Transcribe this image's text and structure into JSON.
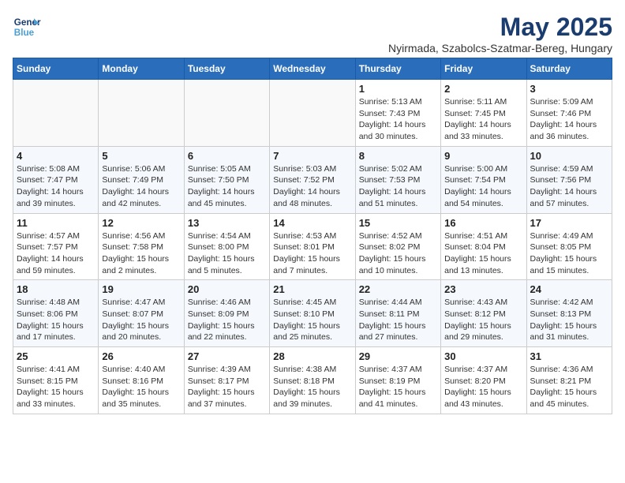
{
  "logo": {
    "text_general": "General",
    "text_blue": "Blue"
  },
  "title": "May 2025",
  "location": "Nyirmada, Szabolcs-Szatmar-Bereg, Hungary",
  "headers": [
    "Sunday",
    "Monday",
    "Tuesday",
    "Wednesday",
    "Thursday",
    "Friday",
    "Saturday"
  ],
  "weeks": [
    [
      {
        "day": "",
        "info": ""
      },
      {
        "day": "",
        "info": ""
      },
      {
        "day": "",
        "info": ""
      },
      {
        "day": "",
        "info": ""
      },
      {
        "day": "1",
        "info": "Sunrise: 5:13 AM\nSunset: 7:43 PM\nDaylight: 14 hours\nand 30 minutes."
      },
      {
        "day": "2",
        "info": "Sunrise: 5:11 AM\nSunset: 7:45 PM\nDaylight: 14 hours\nand 33 minutes."
      },
      {
        "day": "3",
        "info": "Sunrise: 5:09 AM\nSunset: 7:46 PM\nDaylight: 14 hours\nand 36 minutes."
      }
    ],
    [
      {
        "day": "4",
        "info": "Sunrise: 5:08 AM\nSunset: 7:47 PM\nDaylight: 14 hours\nand 39 minutes."
      },
      {
        "day": "5",
        "info": "Sunrise: 5:06 AM\nSunset: 7:49 PM\nDaylight: 14 hours\nand 42 minutes."
      },
      {
        "day": "6",
        "info": "Sunrise: 5:05 AM\nSunset: 7:50 PM\nDaylight: 14 hours\nand 45 minutes."
      },
      {
        "day": "7",
        "info": "Sunrise: 5:03 AM\nSunset: 7:52 PM\nDaylight: 14 hours\nand 48 minutes."
      },
      {
        "day": "8",
        "info": "Sunrise: 5:02 AM\nSunset: 7:53 PM\nDaylight: 14 hours\nand 51 minutes."
      },
      {
        "day": "9",
        "info": "Sunrise: 5:00 AM\nSunset: 7:54 PM\nDaylight: 14 hours\nand 54 minutes."
      },
      {
        "day": "10",
        "info": "Sunrise: 4:59 AM\nSunset: 7:56 PM\nDaylight: 14 hours\nand 57 minutes."
      }
    ],
    [
      {
        "day": "11",
        "info": "Sunrise: 4:57 AM\nSunset: 7:57 PM\nDaylight: 14 hours\nand 59 minutes."
      },
      {
        "day": "12",
        "info": "Sunrise: 4:56 AM\nSunset: 7:58 PM\nDaylight: 15 hours\nand 2 minutes."
      },
      {
        "day": "13",
        "info": "Sunrise: 4:54 AM\nSunset: 8:00 PM\nDaylight: 15 hours\nand 5 minutes."
      },
      {
        "day": "14",
        "info": "Sunrise: 4:53 AM\nSunset: 8:01 PM\nDaylight: 15 hours\nand 7 minutes."
      },
      {
        "day": "15",
        "info": "Sunrise: 4:52 AM\nSunset: 8:02 PM\nDaylight: 15 hours\nand 10 minutes."
      },
      {
        "day": "16",
        "info": "Sunrise: 4:51 AM\nSunset: 8:04 PM\nDaylight: 15 hours\nand 13 minutes."
      },
      {
        "day": "17",
        "info": "Sunrise: 4:49 AM\nSunset: 8:05 PM\nDaylight: 15 hours\nand 15 minutes."
      }
    ],
    [
      {
        "day": "18",
        "info": "Sunrise: 4:48 AM\nSunset: 8:06 PM\nDaylight: 15 hours\nand 17 minutes."
      },
      {
        "day": "19",
        "info": "Sunrise: 4:47 AM\nSunset: 8:07 PM\nDaylight: 15 hours\nand 20 minutes."
      },
      {
        "day": "20",
        "info": "Sunrise: 4:46 AM\nSunset: 8:09 PM\nDaylight: 15 hours\nand 22 minutes."
      },
      {
        "day": "21",
        "info": "Sunrise: 4:45 AM\nSunset: 8:10 PM\nDaylight: 15 hours\nand 25 minutes."
      },
      {
        "day": "22",
        "info": "Sunrise: 4:44 AM\nSunset: 8:11 PM\nDaylight: 15 hours\nand 27 minutes."
      },
      {
        "day": "23",
        "info": "Sunrise: 4:43 AM\nSunset: 8:12 PM\nDaylight: 15 hours\nand 29 minutes."
      },
      {
        "day": "24",
        "info": "Sunrise: 4:42 AM\nSunset: 8:13 PM\nDaylight: 15 hours\nand 31 minutes."
      }
    ],
    [
      {
        "day": "25",
        "info": "Sunrise: 4:41 AM\nSunset: 8:15 PM\nDaylight: 15 hours\nand 33 minutes."
      },
      {
        "day": "26",
        "info": "Sunrise: 4:40 AM\nSunset: 8:16 PM\nDaylight: 15 hours\nand 35 minutes."
      },
      {
        "day": "27",
        "info": "Sunrise: 4:39 AM\nSunset: 8:17 PM\nDaylight: 15 hours\nand 37 minutes."
      },
      {
        "day": "28",
        "info": "Sunrise: 4:38 AM\nSunset: 8:18 PM\nDaylight: 15 hours\nand 39 minutes."
      },
      {
        "day": "29",
        "info": "Sunrise: 4:37 AM\nSunset: 8:19 PM\nDaylight: 15 hours\nand 41 minutes."
      },
      {
        "day": "30",
        "info": "Sunrise: 4:37 AM\nSunset: 8:20 PM\nDaylight: 15 hours\nand 43 minutes."
      },
      {
        "day": "31",
        "info": "Sunrise: 4:36 AM\nSunset: 8:21 PM\nDaylight: 15 hours\nand 45 minutes."
      }
    ]
  ]
}
